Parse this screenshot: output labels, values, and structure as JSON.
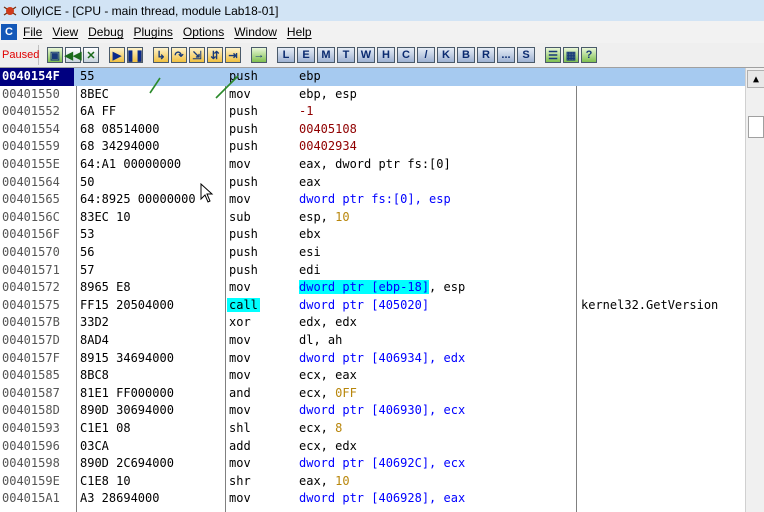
{
  "window": {
    "title": "OllyICE - [CPU - main thread, module Lab18-01]"
  },
  "menu": {
    "mdi_icon": "C",
    "items": [
      "File",
      "View",
      "Debug",
      "Plugins",
      "Options",
      "Window",
      "Help"
    ]
  },
  "toolbar": {
    "status": "Paused",
    "letter_buttons": [
      "L",
      "E",
      "M",
      "T",
      "W",
      "H",
      "C",
      "/",
      "K",
      "B",
      "R",
      "...",
      "S"
    ]
  },
  "rows": [
    {
      "addr": "0040154F",
      "hex": "55",
      "mn": "push",
      "op": "ebp",
      "cm": "",
      "sel": true
    },
    {
      "addr": "00401550",
      "hex": "8BEC",
      "mn": "mov",
      "op": "ebp, esp",
      "cm": ""
    },
    {
      "addr": "00401552",
      "hex": "6A FF",
      "mn": "push",
      "op": "-1",
      "cm": ""
    },
    {
      "addr": "00401554",
      "hex": "68 08514000",
      "mn": "push",
      "op": "00405108",
      "cm": ""
    },
    {
      "addr": "00401559",
      "hex": "68 34294000",
      "mn": "push",
      "op": "00402934",
      "cm": ""
    },
    {
      "addr": "0040155E",
      "hex": "64:A1 00000000",
      "mn": "mov",
      "op": "eax, dword ptr fs:[0]",
      "cm": ""
    },
    {
      "addr": "00401564",
      "hex": "50",
      "mn": "push",
      "op": "eax",
      "cm": ""
    },
    {
      "addr": "00401565",
      "hex": "64:8925 00000000",
      "mn": "mov",
      "op": "dword ptr fs:[0], esp",
      "cm": ""
    },
    {
      "addr": "0040156C",
      "hex": "83EC 10",
      "mn": "sub",
      "op": "esp, 10",
      "cm": ""
    },
    {
      "addr": "0040156F",
      "hex": "53",
      "mn": "push",
      "op": "ebx",
      "cm": ""
    },
    {
      "addr": "00401570",
      "hex": "56",
      "mn": "push",
      "op": "esi",
      "cm": ""
    },
    {
      "addr": "00401571",
      "hex": "57",
      "mn": "push",
      "op": "edi",
      "cm": ""
    },
    {
      "addr": "00401572",
      "hex": "8965 E8",
      "mn": "mov",
      "op": "dword ptr [ebp-18]",
      "op2": ", esp",
      "cm": ""
    },
    {
      "addr": "00401575",
      "hex": "FF15 20504000",
      "mn": "call",
      "op": "dword ptr [405020]",
      "cm": "kernel32.GetVersion"
    },
    {
      "addr": "0040157B",
      "hex": "33D2",
      "mn": "xor",
      "op": "edx, edx",
      "cm": ""
    },
    {
      "addr": "0040157D",
      "hex": "8AD4",
      "mn": "mov",
      "op": "dl, ah",
      "cm": ""
    },
    {
      "addr": "0040157F",
      "hex": "8915 34694000",
      "mn": "mov",
      "op": "dword ptr [406934], edx",
      "cm": ""
    },
    {
      "addr": "00401585",
      "hex": "8BC8",
      "mn": "mov",
      "op": "ecx, eax",
      "cm": ""
    },
    {
      "addr": "00401587",
      "hex": "81E1 FF000000",
      "mn": "and",
      "op": "ecx, 0FF",
      "cm": ""
    },
    {
      "addr": "0040158D",
      "hex": "890D 30694000",
      "mn": "mov",
      "op": "dword ptr [406930], ecx",
      "cm": ""
    },
    {
      "addr": "00401593",
      "hex": "C1E1 08",
      "mn": "shl",
      "op": "ecx, 8",
      "cm": ""
    },
    {
      "addr": "00401596",
      "hex": "03CA",
      "mn": "add",
      "op": "ecx, edx",
      "cm": ""
    },
    {
      "addr": "00401598",
      "hex": "890D 2C694000",
      "mn": "mov",
      "op": "dword ptr [40692C], ecx",
      "cm": ""
    },
    {
      "addr": "0040159E",
      "hex": "C1E8 10",
      "mn": "shr",
      "op": "eax, 10",
      "cm": ""
    },
    {
      "addr": "004015A1",
      "hex": "A3 28694000",
      "mn": "mov",
      "op": "dword ptr [406928], eax",
      "cm": ""
    }
  ]
}
